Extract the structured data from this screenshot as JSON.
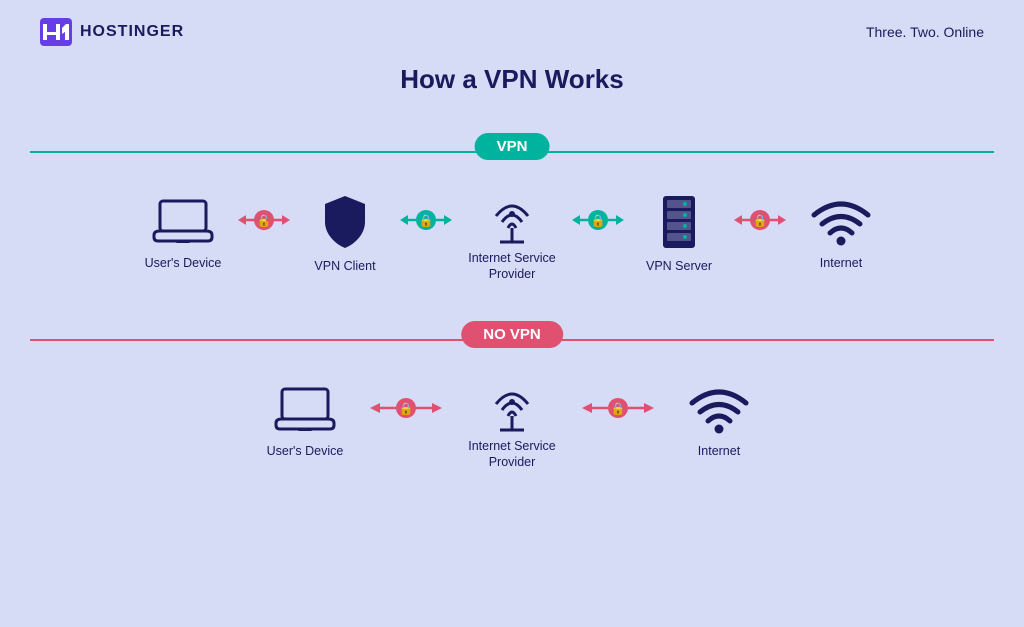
{
  "header": {
    "logo_text": "HOSTINGER",
    "tagline": "Three. Two. Online"
  },
  "page": {
    "title": "How a VPN Works"
  },
  "vpn_section": {
    "badge": "VPN",
    "items": [
      {
        "label": "User's Device",
        "icon": "laptop"
      },
      {
        "label": "VPN Client",
        "icon": "shield"
      },
      {
        "label": "Internet Service\nProvider",
        "icon": "antenna"
      },
      {
        "label": "VPN Server",
        "icon": "server"
      },
      {
        "label": "Internet",
        "icon": "wifi"
      }
    ],
    "connectors": [
      {
        "type": "red"
      },
      {
        "type": "green"
      },
      {
        "type": "green"
      },
      {
        "type": "red"
      }
    ]
  },
  "novpn_section": {
    "badge": "NO VPN",
    "items": [
      {
        "label": "User's Device",
        "icon": "laptop"
      },
      {
        "label": "Internet Service\nProvider",
        "icon": "antenna"
      },
      {
        "label": "Internet",
        "icon": "wifi"
      }
    ],
    "connectors": [
      {
        "type": "red"
      },
      {
        "type": "red"
      }
    ]
  }
}
